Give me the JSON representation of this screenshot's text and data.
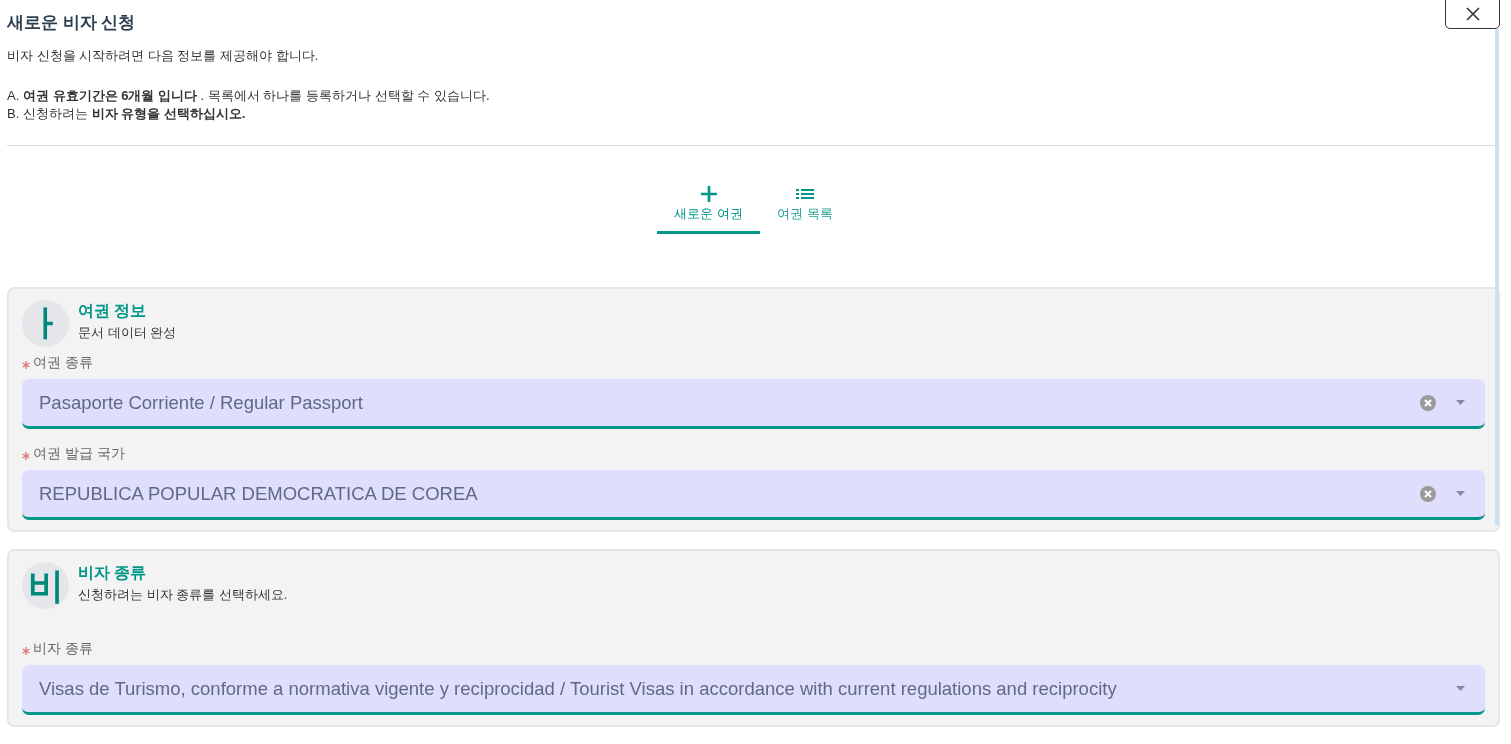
{
  "dialog": {
    "title": "새로운 비자 신청",
    "intro": "비자 신청을 시작하려면 다음 정보를 제공해야 합니다.",
    "notes": [
      "A. **여권 유효기간은 6개월 입니다** . 목록에서 하나를 등록하거나 선택할 수 있습니다.",
      "B. 신청하려는 **비자 유형을 선택하십시오.**"
    ]
  },
  "tabs": [
    {
      "kind": "add",
      "label": "새로운 여권",
      "selected": true
    },
    {
      "kind": "list",
      "label": "여권 목록",
      "selected": false
    }
  ],
  "sections": [
    {
      "avatar": "ㅏ",
      "title": "여권 정보",
      "subtitle": "문서 데이터 완성",
      "fields": [
        {
          "label": "여권 종류",
          "required": true,
          "value": "Pasaporte Corriente / Regular Passport",
          "clearable": true
        },
        {
          "label": "여권 발급 국가",
          "required": true,
          "value": "REPUBLICA POPULAR DEMOCRATICA DE COREA",
          "clearable": true
        }
      ]
    },
    {
      "avatar": "비",
      "title": "비자 종류",
      "subtitle": "신청하려는 비자 종류를 선택하세요.",
      "fields": [
        {
          "label": "비자 종류",
          "required": true,
          "value": "Visas de Turismo, conforme a normativa vigente y reciprocidad / Tourist Visas in accordance with current regulations and reciprocity",
          "clearable": false
        }
      ]
    }
  ]
}
